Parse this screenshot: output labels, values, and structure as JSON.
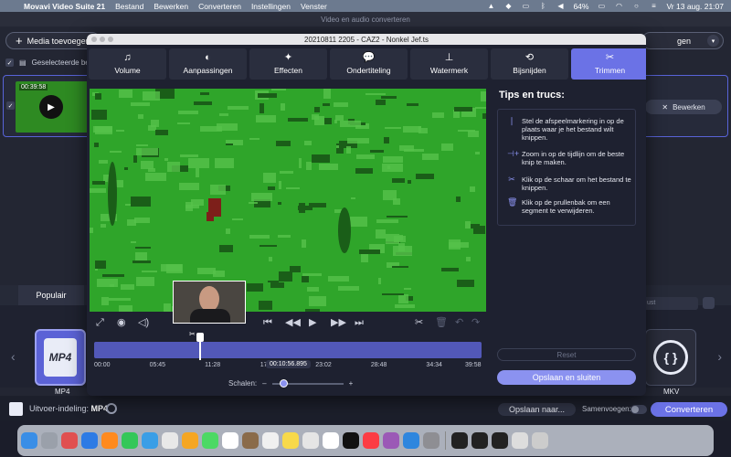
{
  "menubar": {
    "app_name": "Movavi Video Suite 21",
    "items": [
      "Bestand",
      "Bewerken",
      "Converteren",
      "Instellingen",
      "Venster"
    ],
    "battery": "64%",
    "datetime": "Vr 13 aug.  21:07"
  },
  "main_window": {
    "title": "Video en audio converteren",
    "add_media_label": "Media toevoegen",
    "right_pill_label": "gen",
    "selected_label": "Geselecteerde be",
    "file": {
      "duration": "00:39:58",
      "edit_label": "Bewerken"
    }
  },
  "formats": {
    "tab_label": "Populair",
    "cards": [
      {
        "label": "MP4",
        "icon_text": "MP4"
      },
      {
        "label": "MKV",
        "icon_text": "{ }"
      }
    ],
    "search_placeholder": "ust"
  },
  "bottombar": {
    "output_label": "Uitvoer-indeling:",
    "output_value": "MP4",
    "save_to_label": "Opslaan naar...",
    "merge_label": "Samenvoegen:",
    "convert_label": "Converteren"
  },
  "dialog": {
    "title": "20210811 2205 - CAZ2 - Nonkel Jef.ts",
    "tabs": [
      {
        "label": "Volume",
        "icon": "music-note-icon",
        "glyph": "♫"
      },
      {
        "label": "Aanpassingen",
        "icon": "contrast-icon",
        "glyph": "◐"
      },
      {
        "label": "Effecten",
        "icon": "magic-wand-icon",
        "glyph": "✦"
      },
      {
        "label": "Ondertiteling",
        "icon": "speech-bubble-icon",
        "glyph": "💬"
      },
      {
        "label": "Watermerk",
        "icon": "stamp-icon",
        "glyph": "⊥"
      },
      {
        "label": "Bijsnijden",
        "icon": "crop-rotate-icon",
        "glyph": "⟲"
      },
      {
        "label": "Trimmen",
        "icon": "scissors-icon",
        "glyph": "✂"
      }
    ],
    "active_tab": "Trimmen",
    "tips_title": "Tips en trucs:",
    "tips": [
      {
        "icon": "marker-icon",
        "glyph": "❘",
        "text": "Stel de afspeelmarkering in op de plaats waar je het bestand wilt knippen."
      },
      {
        "icon": "zoom-timeline-icon",
        "glyph": "⊣+",
        "text": "Zoom in op de tijdlijn om de beste knip te maken."
      },
      {
        "icon": "scissors-icon",
        "glyph": "✂",
        "text": "Klik op de schaar om het bestand te knippen."
      },
      {
        "icon": "trash-icon",
        "glyph": "🗑",
        "text": "Klik op de prullenbak om een segment te verwijderen."
      }
    ],
    "reset_label": "Reset",
    "save_close_label": "Opslaan en sluiten",
    "timeline": {
      "ticks": [
        "00:00",
        "05:45",
        "11:28",
        "17:17",
        "23:02",
        "28:48",
        "34:34",
        "39:58"
      ],
      "current_time": "00:10:56.895",
      "playhead_fraction": 0.274,
      "scale_label": "Schalen:",
      "scale_minus": "–",
      "scale_plus": "+"
    }
  }
}
